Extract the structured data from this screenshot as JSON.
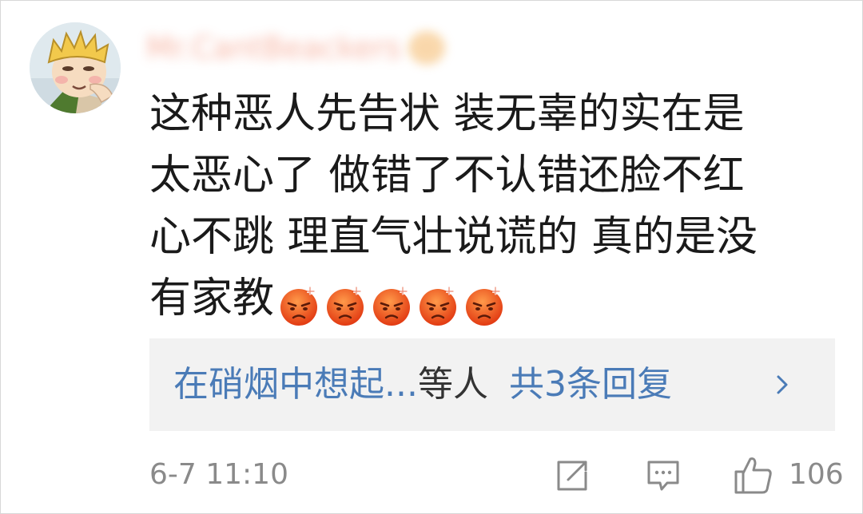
{
  "comment": {
    "author": {
      "name": "Mr.CantBeackers",
      "avatar": "cartoon-boy-avatar"
    },
    "text_lines": [
      "这种恶人先告状 装无辜的实在是",
      "太恶心了 做错了不认错还脸不红",
      "心不跳 理直气壮说谎的 真的是没",
      "有家教"
    ],
    "emoji": {
      "name": "angry-face",
      "count": 5
    },
    "replies": {
      "author": "在硝烟中想起...",
      "preview": "等人",
      "count_label": "共3条回复"
    },
    "timestamp": "6-7 11:10",
    "likes": "106"
  },
  "colors": {
    "link": "#4a7bb7",
    "meta": "#8a8a8a",
    "reply_bg": "#f2f2f2"
  }
}
